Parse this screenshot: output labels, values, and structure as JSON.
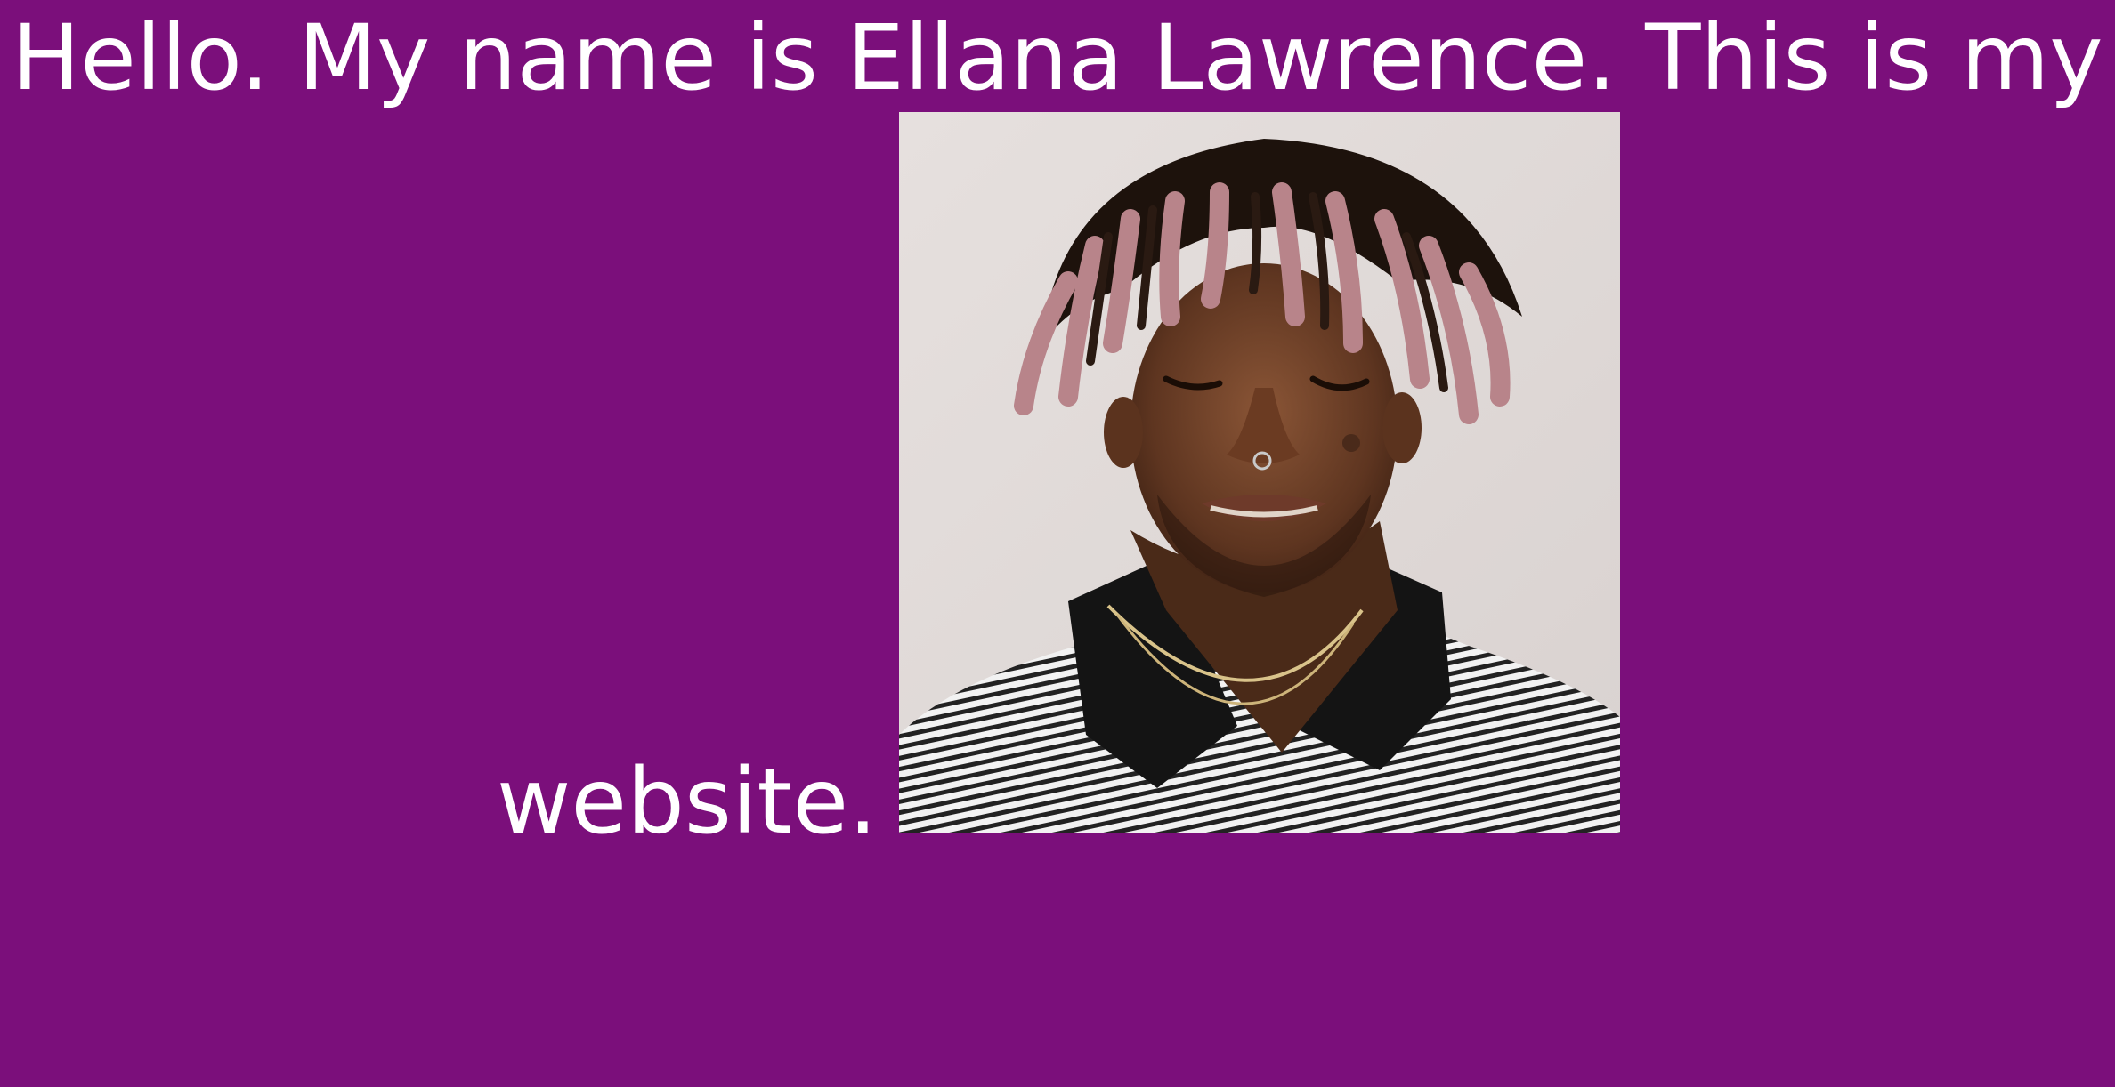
{
  "page": {
    "background_color": "#7b0f7b",
    "text_color": "#ffffff"
  },
  "headline": {
    "line1": "Hello. My name is Ellana Lawrence. This is my",
    "line2": "website."
  },
  "photo": {
    "icon": "portrait-photo"
  }
}
